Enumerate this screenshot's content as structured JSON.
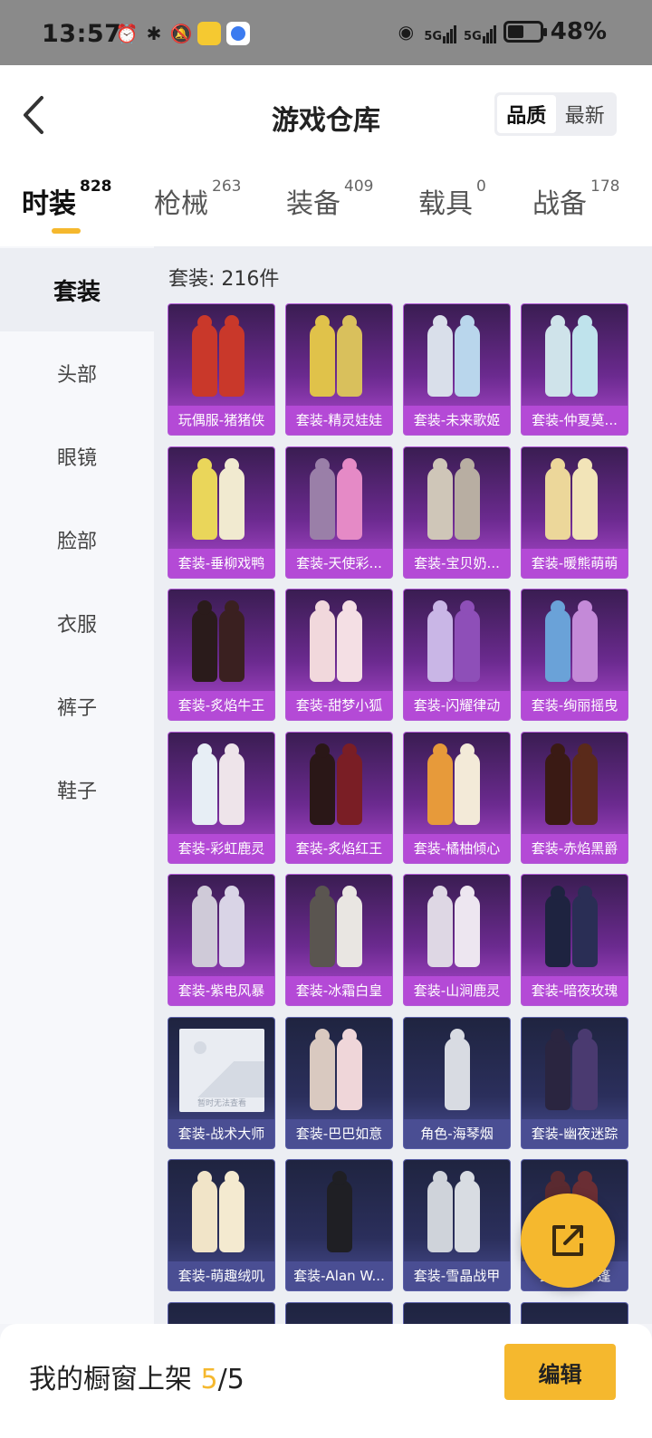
{
  "status_bar": {
    "time": "13:57",
    "battery": "48%",
    "network": "5G"
  },
  "header": {
    "title": "游戏仓库",
    "sort": {
      "options": [
        "品质",
        "最新"
      ],
      "selected": "品质"
    }
  },
  "tabs": [
    {
      "label": "时装",
      "count": "828",
      "active": true
    },
    {
      "label": "枪械",
      "count": "263",
      "active": false
    },
    {
      "label": "装备",
      "count": "409",
      "active": false
    },
    {
      "label": "载具",
      "count": "0",
      "active": false
    },
    {
      "label": "战备",
      "count": "178",
      "active": false
    }
  ],
  "sidebar": {
    "items": [
      "套装",
      "头部",
      "眼镜",
      "脸部",
      "衣服",
      "裤子",
      "鞋子"
    ],
    "selected": "套装"
  },
  "content": {
    "count_label": "套装: 216件",
    "items": [
      {
        "name": "玩偶服-猪猪侠",
        "tier": "purple",
        "colors": [
          "#c9382a",
          "#c9382a"
        ]
      },
      {
        "name": "套装-精灵娃娃",
        "tier": "purple",
        "colors": [
          "#e0c24a",
          "#d9c05c"
        ]
      },
      {
        "name": "套装-未来歌姬",
        "tier": "purple",
        "colors": [
          "#d9dfea",
          "#b9d6ec"
        ]
      },
      {
        "name": "套装-仲夏莫...",
        "tier": "purple",
        "colors": [
          "#cfe3ea",
          "#bfe3ec"
        ]
      },
      {
        "name": "套装-垂柳戏鸭",
        "tier": "purple",
        "colors": [
          "#ead65a",
          "#f1ead0"
        ]
      },
      {
        "name": "套装-天使彩...",
        "tier": "purple",
        "colors": [
          "#9a7fa8",
          "#e58ac6"
        ]
      },
      {
        "name": "套装-宝贝奶...",
        "tier": "purple",
        "colors": [
          "#cfc6b8",
          "#b8aea2"
        ]
      },
      {
        "name": "套装-暖熊萌萌",
        "tier": "purple",
        "colors": [
          "#ecd79a",
          "#f2e4b8"
        ]
      },
      {
        "name": "套装-炙焰牛王",
        "tier": "purple",
        "colors": [
          "#2a1b1b",
          "#3a2020"
        ]
      },
      {
        "name": "套装-甜梦小狐",
        "tier": "purple",
        "colors": [
          "#f1d8dc",
          "#f4dfe4"
        ]
      },
      {
        "name": "套装-闪耀律动",
        "tier": "purple",
        "colors": [
          "#c9b6e6",
          "#8e4fb8"
        ]
      },
      {
        "name": "套装-绚丽摇曳",
        "tier": "purple",
        "colors": [
          "#6aa2d8",
          "#c48ad8"
        ]
      },
      {
        "name": "套装-彩虹鹿灵",
        "tier": "purple",
        "colors": [
          "#e7eef5",
          "#eee4ea"
        ]
      },
      {
        "name": "套装-炙焰红王",
        "tier": "purple",
        "colors": [
          "#2a1717",
          "#7a1e25"
        ]
      },
      {
        "name": "套装-橘柚倾心",
        "tier": "purple",
        "colors": [
          "#e79a3a",
          "#f3ead8"
        ]
      },
      {
        "name": "套装-赤焰黑爵",
        "tier": "purple",
        "colors": [
          "#3a1a14",
          "#5a2a1a"
        ]
      },
      {
        "name": "套装-紫电风暴",
        "tier": "purple",
        "colors": [
          "#cfcad8",
          "#d9d4e6"
        ]
      },
      {
        "name": "套装-冰霜白皇",
        "tier": "purple",
        "colors": [
          "#5a5550",
          "#e9e6e2"
        ]
      },
      {
        "name": "套装-山涧鹿灵",
        "tier": "purple",
        "colors": [
          "#ded7e4",
          "#ede6f0"
        ]
      },
      {
        "name": "套装-暗夜玫瑰",
        "tier": "purple",
        "colors": [
          "#1e2340",
          "#2a2e55"
        ]
      },
      {
        "name": "套装-战术大师",
        "tier": "blue",
        "placeholder": "暂时无法查看"
      },
      {
        "name": "套装-巴巴如意",
        "tier": "blue",
        "colors": [
          "#d9c9c0",
          "#efd6d9"
        ]
      },
      {
        "name": "角色-海琴烟",
        "tier": "blue",
        "colors": [
          "#d8dbe2"
        ]
      },
      {
        "name": "套装-幽夜迷踪",
        "tier": "blue",
        "colors": [
          "#2a2540",
          "#4a3a70"
        ]
      },
      {
        "name": "套装-萌趣绒叽",
        "tier": "blue",
        "colors": [
          "#f1e4c8",
          "#f4ead0"
        ]
      },
      {
        "name": "套装-Alan W...",
        "tier": "blue",
        "colors": [
          "#1f1f24"
        ]
      },
      {
        "name": "套装-雪晶战甲",
        "tier": "blue",
        "colors": [
          "#cfd3da",
          "#d8dce2"
        ]
      },
      {
        "name": "套装-...斗篷",
        "tier": "blue",
        "colors": [
          "#5a2a30",
          "#6a2e34"
        ]
      }
    ]
  },
  "bottom_bar": {
    "text_prefix": "我的橱窗上架 ",
    "current": "5",
    "total": "/5",
    "edit_label": "编辑"
  },
  "accent_color": "#f5b82e"
}
